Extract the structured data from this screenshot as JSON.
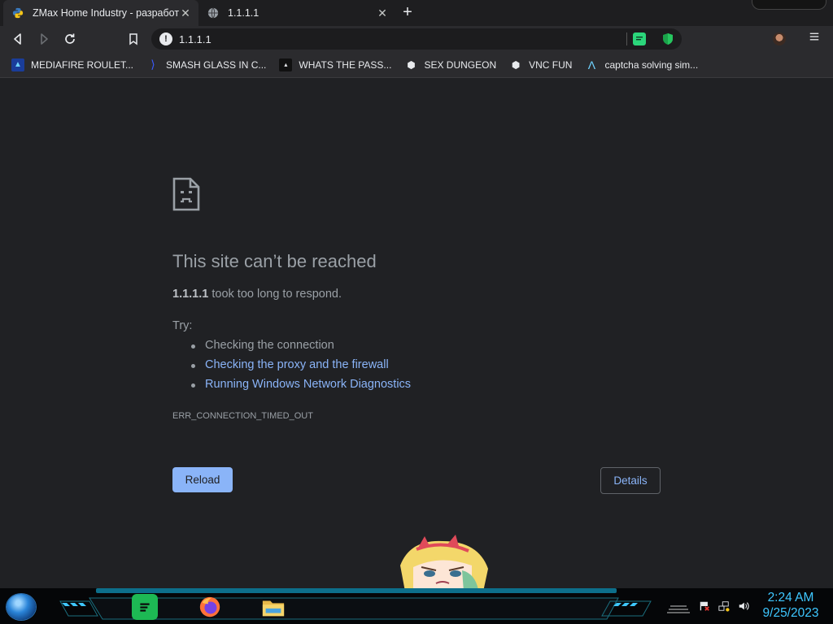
{
  "browser": {
    "tabs": [
      {
        "title": "ZMax Home Industry - разработк",
        "active": true,
        "favicon": "python-favicon"
      },
      {
        "title": "1.1.1.1",
        "active": false,
        "favicon": "globe-favicon"
      }
    ],
    "new_tab_label": "+",
    "address_bar": {
      "url": "1.1.1.1",
      "security_icon": "info-icon"
    },
    "extensions": [
      {
        "name": "chat-extension-icon",
        "color": "#2bd67b"
      },
      {
        "name": "shield-extension-icon",
        "color": "#1aa34a"
      }
    ],
    "bookmarks": [
      {
        "label": "MEDIAFIRE ROULET...",
        "icon": "mediafire-icon"
      },
      {
        "label": "SMASH GLASS IN C...",
        "icon": "chevron-logo-icon"
      },
      {
        "label": "WHATS THE PASS...",
        "icon": "lock-icon"
      },
      {
        "label": "SEX DUNGEON",
        "icon": "badge-icon"
      },
      {
        "label": "VNC FUN",
        "icon": "badge-icon"
      },
      {
        "label": "captcha solving sim...",
        "icon": "lambda-icon"
      }
    ]
  },
  "error_page": {
    "title": "This site can’t be reached",
    "host": "1.1.1.1",
    "description_suffix": " took too long to respond.",
    "try_label": "Try:",
    "suggestions": [
      {
        "text": "Checking the connection",
        "is_link": false
      },
      {
        "text": "Checking the proxy and the firewall",
        "is_link": true
      },
      {
        "text": "Running Windows Network Diagnostics",
        "is_link": true
      }
    ],
    "error_code": "ERR_CONNECTION_TIMED_OUT",
    "reload_label": "Reload",
    "details_label": "Details"
  },
  "taskbar": {
    "apps": [
      "spotify-icon",
      "firefox-icon",
      "file-explorer-icon"
    ],
    "tray_icons": [
      "action-center-flag-icon",
      "network-icon",
      "volume-icon"
    ],
    "clock": {
      "time": "2:24 AM",
      "date": "9/25/2023"
    },
    "accent_color": "#3ec7ff"
  },
  "colors": {
    "page_bg": "#202124",
    "link": "#8ab4f8",
    "text_secondary": "#9aa0a6",
    "button_primary": "#8ab4f8"
  }
}
